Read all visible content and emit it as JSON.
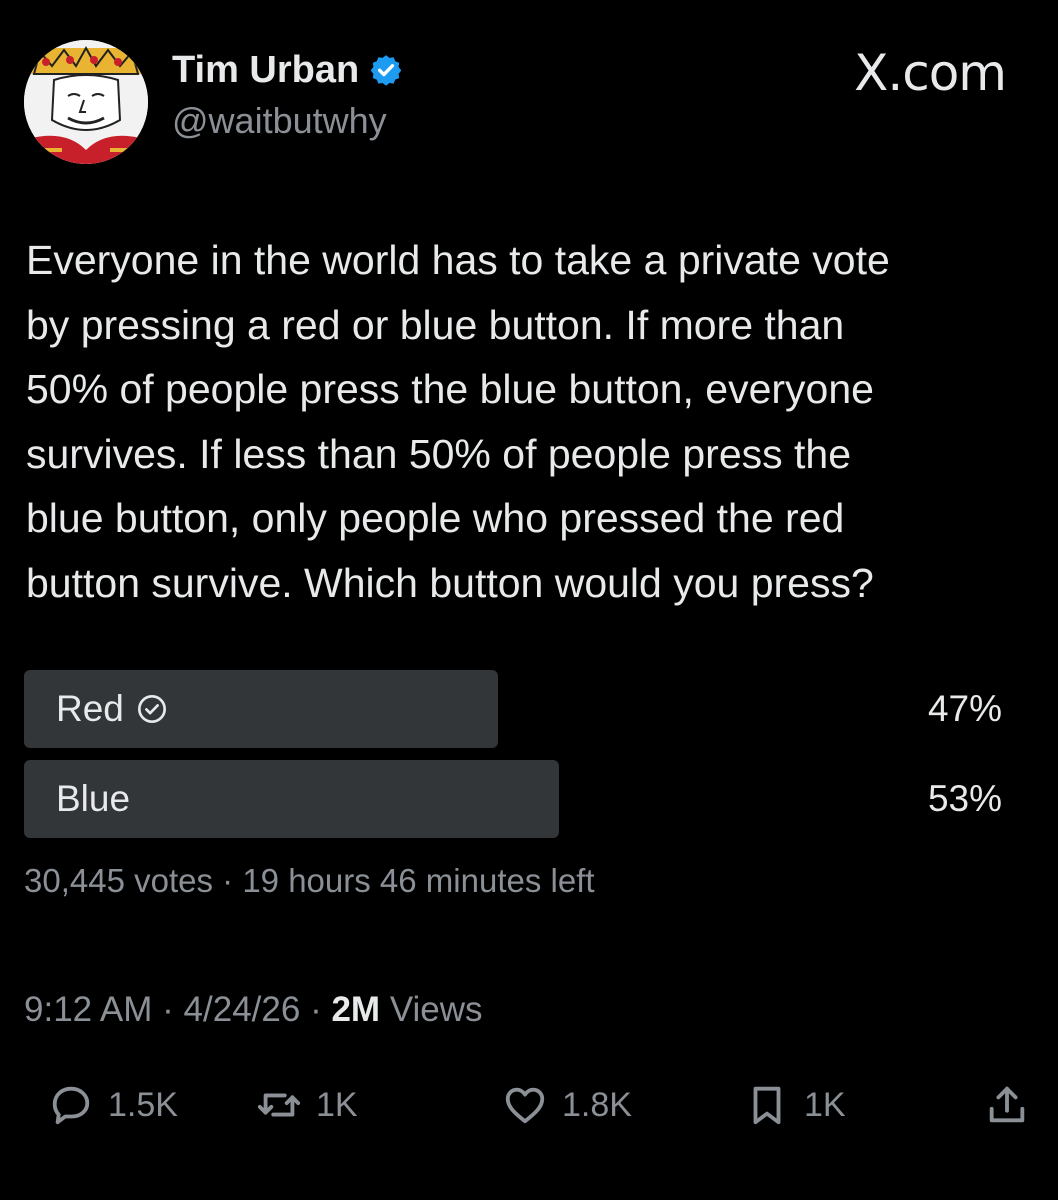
{
  "author": {
    "name": "Tim Urban",
    "handle": "@waitbutwhy",
    "avatar_icon": "king-of-hearts-card-avatar",
    "verified_icon": "verified-badge-icon",
    "verified_color": "#1d9bf0"
  },
  "brand": "X.com",
  "tweet": {
    "lines": [
      "Everyone in the world has to take a private vote",
      "by pressing a red or blue button. If more than",
      "50% of people press the blue button, everyone",
      "survives. If less than 50% of people press the",
      "blue button, only people who pressed the red",
      "button survive. Which button would you press?"
    ]
  },
  "poll": {
    "options": [
      {
        "label": "Red",
        "percent_text": "47%",
        "share": 0.47,
        "selected": true,
        "check_icon": "check-circle-icon"
      },
      {
        "label": "Blue",
        "percent_text": "53%",
        "share": 0.53,
        "selected": false
      }
    ],
    "votes": "30,445 votes",
    "separator": "·",
    "time_left": "19 hours 46 minutes left"
  },
  "meta": {
    "time": "9:12 AM",
    "date": "4/24/26",
    "separator": "·",
    "views_count": "2M",
    "views_label": "Views"
  },
  "actions": {
    "reply": {
      "icon": "reply-icon",
      "count": "1.5K"
    },
    "repost": {
      "icon": "repost-icon",
      "count": "1K"
    },
    "like": {
      "icon": "heart-icon",
      "count": "1.8K"
    },
    "bookmark": {
      "icon": "bookmark-icon",
      "count": "1K"
    },
    "share": {
      "icon": "share-icon"
    }
  },
  "colors": {
    "background": "#000000",
    "text": "#e7e9ea",
    "secondary_text": "#8b9096",
    "poll_bar": "#333639"
  }
}
